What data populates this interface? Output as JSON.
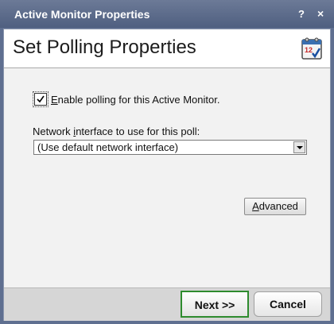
{
  "window": {
    "title": "Active Monitor Properties",
    "help_glyph": "?",
    "close_glyph": "×"
  },
  "header": {
    "heading": "Set Polling Properties",
    "icon": "calendar-icon",
    "icon_day": "12"
  },
  "form": {
    "enable_polling": {
      "checked": true,
      "label_first": "E",
      "label_rest": "nable polling for this Active Monitor."
    },
    "network_interface": {
      "label_pre": "Network ",
      "label_ul": "i",
      "label_post": "nterface to use for this poll:",
      "selected": "(Use default network interface)"
    },
    "advanced": {
      "label_first": "A",
      "label_rest": "dvanced"
    }
  },
  "footer": {
    "next_label": "Next >>",
    "cancel_label": "Cancel"
  },
  "colors": {
    "titlebar": "#5f6f90",
    "next_border": "#2e8b2e"
  }
}
